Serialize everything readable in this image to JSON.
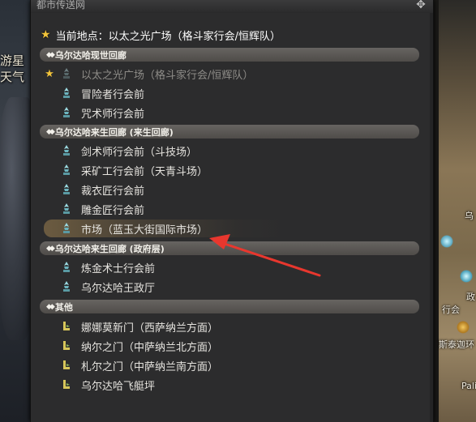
{
  "background": {
    "left_text": [
      "游星",
      "天气"
    ],
    "map_labels": [
      "乌",
      "政",
      "行会",
      "斯泰迦环",
      "Pali"
    ]
  },
  "window": {
    "title": "都市传送网",
    "current_location_label": "当前地点：以太之光广场（格斗家行会/恒辉队）"
  },
  "categories": [
    {
      "name": "乌尔达哈现世回廊",
      "items": [
        {
          "label": "以太之光广场（格斗家行会/恒辉队）",
          "favorite": true,
          "current": true,
          "icon": "aetheryte-icon"
        },
        {
          "label": "冒险者行会前",
          "favorite": false,
          "current": false,
          "icon": "aetheryte-icon"
        },
        {
          "label": "咒术师行会前",
          "favorite": false,
          "current": false,
          "icon": "aetheryte-icon"
        }
      ]
    },
    {
      "name": "乌尔达哈来生回廊 (来生回廊)",
      "items": [
        {
          "label": "剑术师行会前（斗技场）",
          "icon": "aetheryte-icon"
        },
        {
          "label": "采矿工行会前（天青斗场）",
          "icon": "aetheryte-icon"
        },
        {
          "label": "裁衣匠行会前",
          "icon": "aetheryte-icon"
        },
        {
          "label": "雕金匠行会前",
          "icon": "aetheryte-icon"
        },
        {
          "label": "市场（蓝玉大街国际市场）",
          "icon": "aetheryte-icon",
          "highlighted": true
        }
      ]
    },
    {
      "name": "乌尔达哈来生回廊 (政府层)",
      "items": [
        {
          "label": "炼金术士行会前",
          "icon": "aetheryte-icon"
        },
        {
          "label": "乌尔达哈王政厅",
          "icon": "aetheryte-icon"
        }
      ]
    },
    {
      "name": "其他",
      "items": [
        {
          "label": "娜娜莫新门（西萨纳兰方面）",
          "icon": "gate-icon"
        },
        {
          "label": "纳尔之门（中萨纳兰北方面）",
          "icon": "gate-icon"
        },
        {
          "label": "札尔之门（中萨纳兰南方面）",
          "icon": "gate-icon"
        },
        {
          "label": "乌尔达哈飞艇坪",
          "icon": "gate-icon"
        }
      ]
    }
  ],
  "colors": {
    "window_bg": "#2c2c2d",
    "category_bar": "#5c5956",
    "star": "#f2c43a",
    "item_text": "#e6e4df",
    "current_item_text": "#8e8c88",
    "aetheryte_icon": "#9ad9e0",
    "gate_icon": "#d7c65a",
    "annotation_arrow": "#e8372e"
  }
}
